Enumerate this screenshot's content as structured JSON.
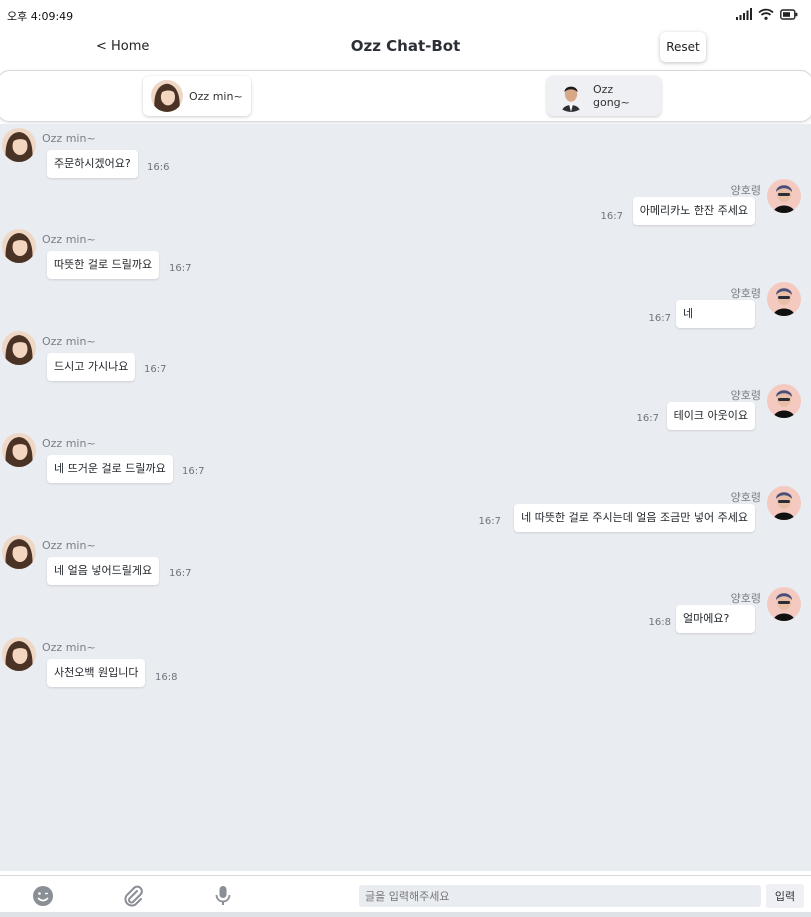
{
  "status_bar": {
    "time": "오후 4:09:49"
  },
  "header": {
    "home_label": "< Home",
    "title": "Ozz Chat-Bot",
    "reset_label": "Reset"
  },
  "bots": [
    {
      "name": "Ozz min~"
    },
    {
      "name": "Ozz gong~"
    }
  ],
  "messages": [
    {
      "side": "bot",
      "sender": "Ozz min~",
      "text": "주문하시겠어요?",
      "time": "16:6"
    },
    {
      "side": "user",
      "sender": "양호령",
      "text": "아메리카노 한잔 주세요",
      "time": "16:7"
    },
    {
      "side": "bot",
      "sender": "Ozz min~",
      "text": "따뜻한 걸로 드릴까요",
      "time": "16:7"
    },
    {
      "side": "user",
      "sender": "양호령",
      "text": "네",
      "time": "16:7"
    },
    {
      "side": "bot",
      "sender": "Ozz min~",
      "text": "드시고 가시나요",
      "time": "16:7"
    },
    {
      "side": "user",
      "sender": "양호령",
      "text": "테이크 아웃이요",
      "time": "16:7"
    },
    {
      "side": "bot",
      "sender": "Ozz min~",
      "text": "네 뜨거운 걸로 드릴까요",
      "time": "16:7"
    },
    {
      "side": "user",
      "sender": "양호령",
      "text": "네 따뜻한 걸로 주시는데 얼음 조금만 넣어 주세요",
      "time": "16:7"
    },
    {
      "side": "bot",
      "sender": "Ozz min~",
      "text": "네 얼음 넣어드릴게요",
      "time": "16:7"
    },
    {
      "side": "user",
      "sender": "양호령",
      "text": "얼마에요?",
      "time": "16:8"
    },
    {
      "side": "bot",
      "sender": "Ozz min~",
      "text": "사천오백 원입니다",
      "time": "16:8"
    }
  ],
  "composer": {
    "placeholder": "글을 입력해주세요",
    "send_label": "입력"
  },
  "icons": {
    "emoji": "emoji-icon",
    "attach": "paperclip-icon",
    "mic": "microphone-icon"
  },
  "colors": {
    "chat_background": "#e9ecf1",
    "bubble": "#ffffff",
    "muted_text": "#7a7f87"
  }
}
